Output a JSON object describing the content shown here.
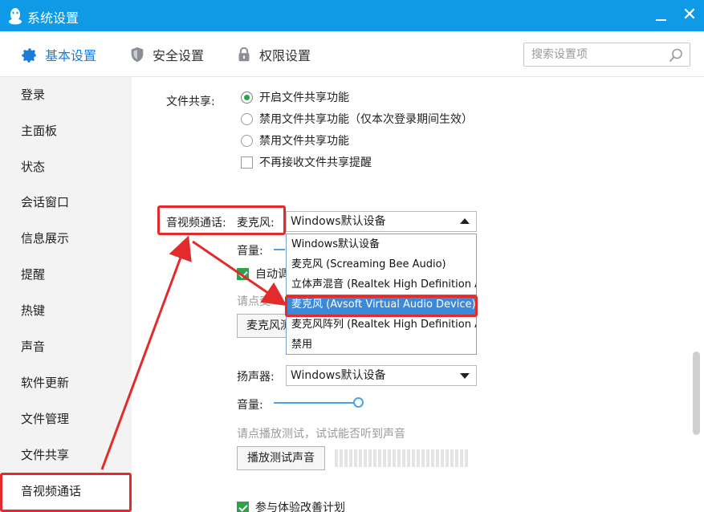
{
  "window": {
    "title": "系统设置",
    "minimize_glyph": "_",
    "close_glyph": "✕"
  },
  "topnav": {
    "tabs": [
      {
        "label": "基本设置",
        "icon": "gear-icon",
        "active": true
      },
      {
        "label": "安全设置",
        "icon": "shield-icon",
        "active": false
      },
      {
        "label": "权限设置",
        "icon": "lock-icon",
        "active": false
      }
    ],
    "search_placeholder": "搜索设置项"
  },
  "sidebar": {
    "items": [
      {
        "label": "登录"
      },
      {
        "label": "主面板"
      },
      {
        "label": "状态"
      },
      {
        "label": "会话窗口"
      },
      {
        "label": "信息展示"
      },
      {
        "label": "提醒"
      },
      {
        "label": "热键"
      },
      {
        "label": "声音"
      },
      {
        "label": "软件更新"
      },
      {
        "label": "文件管理"
      },
      {
        "label": "文件共享"
      },
      {
        "label": "音视频通话",
        "active": true
      }
    ]
  },
  "file_share": {
    "label": "文件共享:",
    "options": [
      {
        "label": "开启文件共享功能",
        "type": "radio",
        "checked": true
      },
      {
        "label": "禁用文件共享功能（仅本次登录期间生效）",
        "type": "radio",
        "checked": false
      },
      {
        "label": "禁用文件共享功能",
        "type": "radio",
        "checked": false
      },
      {
        "label": "不再接收文件共享提醒",
        "type": "checkbox",
        "checked": false
      }
    ]
  },
  "av_call": {
    "section_label": "音视频通话:",
    "mic_label": "麦克风:",
    "mic_selected": "Windows默认设备",
    "mic_options": [
      "Windows默认设备",
      "麦克风 (Screaming Bee Audio)",
      "立体声混音 (Realtek High Definition A",
      "麦克风 (Avsoft Virtual Audio Device)",
      "麦克风阵列 (Realtek High Definition A",
      "禁用"
    ],
    "highlighted_option_index": 3,
    "volume_label": "音量:",
    "auto_adjust_label": "自动调",
    "mic_hint": "请点麦",
    "mic_test_button": "麦克风测",
    "speaker_label": "扬声器:",
    "speaker_selected": "Windows默认设备",
    "speaker_volume_label": "音量:",
    "speaker_volume_level": 1.0,
    "play_hint": "请点播放测试，试试能否听到声音",
    "play_test_button": "播放测试声音",
    "experience_label": "参与体验改善计划",
    "experience_checked": true
  },
  "colors": {
    "titlebar": "#0e9ae6",
    "accent": "#1a7cd8",
    "check_green": "#2aa34a",
    "selection_blue": "#3b8ad9",
    "annotation_red": "#e42b2b"
  }
}
